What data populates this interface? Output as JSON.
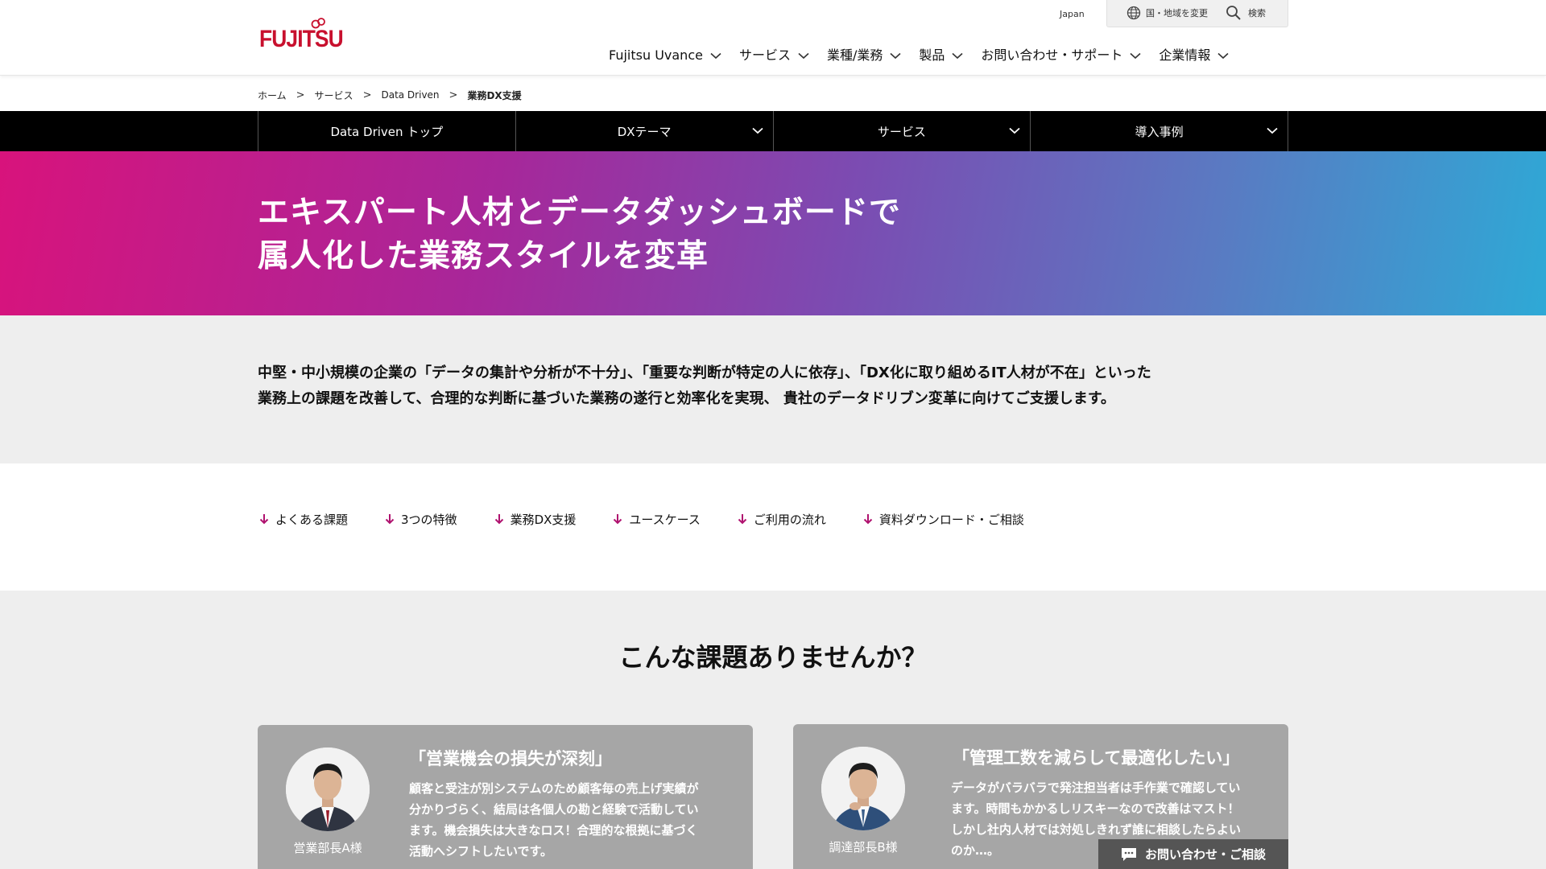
{
  "header": {
    "logo_text": "FUJITSU",
    "region": "Japan",
    "change_country": "国・地域を変更",
    "search": "検索",
    "nav": [
      {
        "label": "Fujitsu Uvance"
      },
      {
        "label": "サービス"
      },
      {
        "label": "業種/業務"
      },
      {
        "label": "製品"
      },
      {
        "label": "お問い合わせ・サポート"
      },
      {
        "label": "企業情報"
      }
    ]
  },
  "breadcrumb": [
    "ホーム",
    "サービス",
    "Data Driven",
    "業務DX支援"
  ],
  "section_nav": [
    {
      "label": "Data Driven トップ"
    },
    {
      "label": "DXテーマ"
    },
    {
      "label": "サービス"
    },
    {
      "label": "導入事例"
    }
  ],
  "hero": {
    "line1": "エキスパート人材とデータダッシュボードで",
    "line2": "属人化した業務スタイルを変革"
  },
  "intro": {
    "line1": "中堅・中小規模の企業の「データの集計や分析が不十分」、「重要な判断が特定の人に依存」、「DX化に取り組めるIT人材が不在」といった",
    "line2": "業務上の課題を改善して、合理的な判断に基づいた業務の遂行と効率化を実現、 貴社のデータドリブン変革に向けてご支援します。"
  },
  "anchors": [
    {
      "label": "よくある課題"
    },
    {
      "label": "3つの特徴"
    },
    {
      "label": "業務DX支援"
    },
    {
      "label": "ユースケース"
    },
    {
      "label": "ご利用の流れ"
    },
    {
      "label": "資料ダウンロード・ご相談"
    }
  ],
  "problems": {
    "title": "こんな課題ありませんか？",
    "cards": [
      {
        "title": "「営業機会の損失が深刻」",
        "person": "営業部長A様",
        "lines": [
          "顧客と受注が別システムのため顧客毎の売上げ実績が",
          "分かりづらく、結局は各個人の勘と経験で活動してい",
          "ます。機会損失は大きなロス！合理的な根拠に基づく",
          "活動へシフトしたいです。"
        ]
      },
      {
        "title": "「管理工数を減らして最適化したい」",
        "person": "調達部長B様",
        "lines": [
          "データがバラバラで発注担当者は手作業で確認してい",
          "ます。時間もかかるしリスキーなので改善はマスト！",
          "しかし社内人材では対処しきれず誰に相談したらよい",
          "のか…。"
        ]
      }
    ]
  },
  "float_contact": {
    "label": "お問い合わせ・ご相談"
  },
  "colors": {
    "brand_red": "#c8102e",
    "anchor_arrow": "#b0126f",
    "section_nav_bg": "#000000"
  }
}
